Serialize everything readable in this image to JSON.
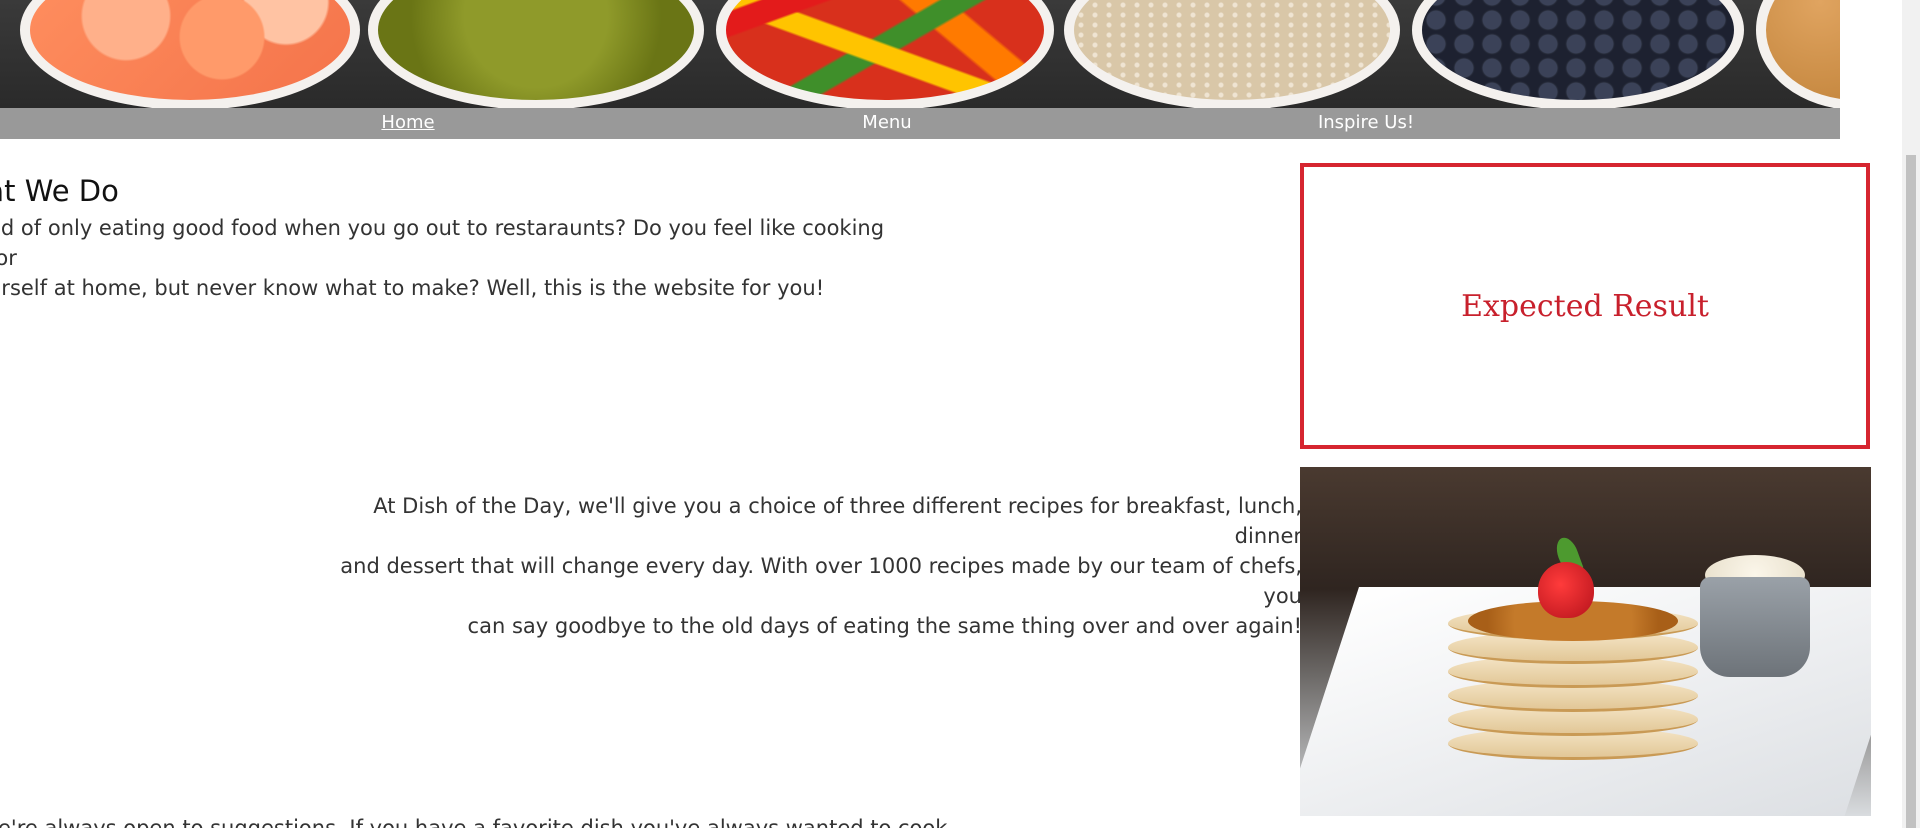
{
  "nav": {
    "items": [
      {
        "label": "Home",
        "active": true
      },
      {
        "label": "Menu",
        "active": false
      },
      {
        "label": "Inspire Us!",
        "active": false
      }
    ]
  },
  "section": {
    "heading": "hat We Do",
    "intro_line1": "ed of only eating good food when you go out to restaraunts? Do you feel like cooking for",
    "intro_line2": "urself at home, but never know what to make? Well, this is the website for you!",
    "detail_line1": "At Dish of the Day, we'll give you a choice of three different recipes for breakfast, lunch, dinner",
    "detail_line2": "and dessert that will change every day. With over 1000 recipes made by our team of chefs, you",
    "detail_line3": "can say goodbye to the old days of eating the same thing over and over again!",
    "bottom_line": "e're always open to suggestions. If you have a favorite dish you've always wanted to cook"
  },
  "expected": {
    "label": "Expected Result"
  },
  "colors": {
    "nav_bg": "#999999",
    "accent_red": "#d62530"
  },
  "icons": {
    "hero": "food-bowls-banner-image",
    "dish": "pancake-stack-image"
  }
}
